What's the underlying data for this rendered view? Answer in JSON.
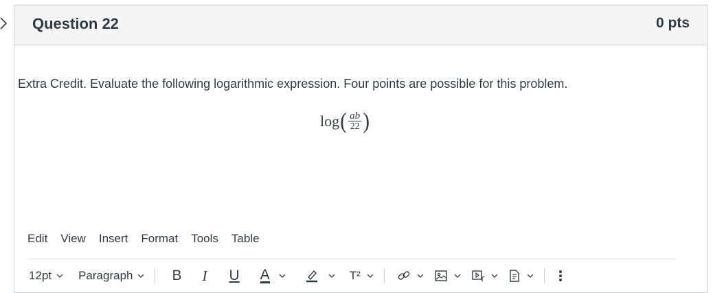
{
  "question": {
    "title": "Question 22",
    "points": "0 pts",
    "text": "Extra Credit. Evaluate the following logarithmic expression. Four points are possible for this problem.",
    "math": {
      "function": "log",
      "left_paren": "(",
      "right_paren": ")",
      "numerator": "ab",
      "denominator": "22"
    }
  },
  "editor": {
    "menu": [
      "Edit",
      "View",
      "Insert",
      "Format",
      "Tools",
      "Table"
    ],
    "toolbar": {
      "font_size": "12pt",
      "block_format": "Paragraph",
      "bold": "B",
      "italic": "I",
      "underline": "U",
      "text_color": "A",
      "superscript": "T²"
    },
    "icons": [
      "chevron-right-icon",
      "highlighter-icon",
      "link-icon",
      "image-icon",
      "media-icon",
      "document-icon",
      "more-vertical-icon"
    ]
  }
}
